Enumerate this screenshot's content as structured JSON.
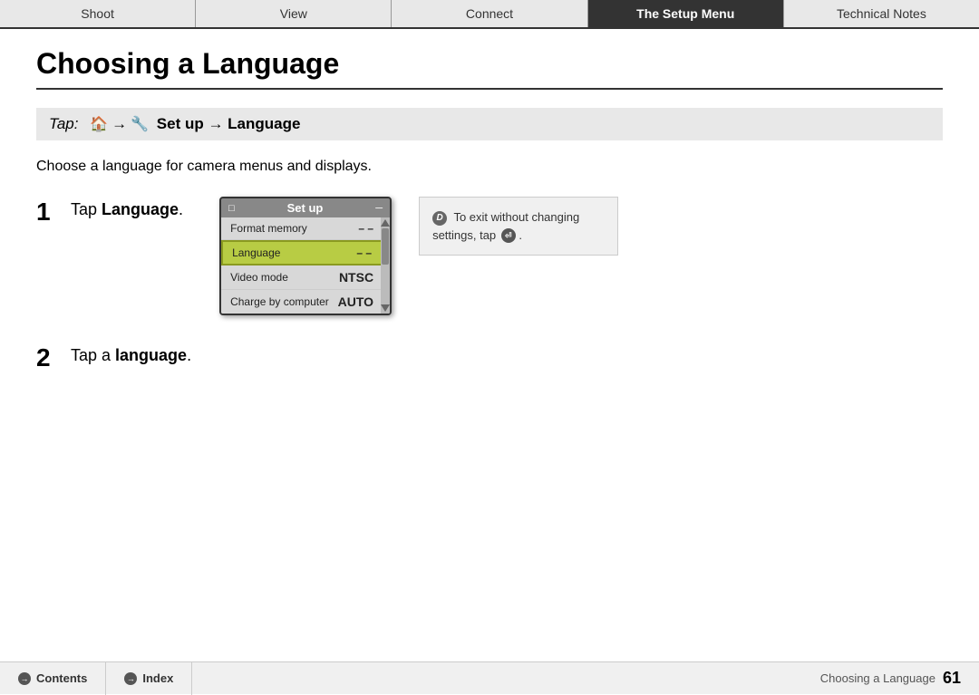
{
  "nav": {
    "tabs": [
      {
        "id": "shoot",
        "label": "Shoot",
        "active": false
      },
      {
        "id": "view",
        "label": "View",
        "active": false
      },
      {
        "id": "connect",
        "label": "Connect",
        "active": false
      },
      {
        "id": "setup",
        "label": "The Setup Menu",
        "active": true
      },
      {
        "id": "technical",
        "label": "Technical Notes",
        "active": false
      }
    ]
  },
  "page": {
    "title": "Choosing a Language",
    "tap_label": "Tap:",
    "tap_instruction": "Set up → Language",
    "description": "Choose a language for camera menus and displays.",
    "steps": [
      {
        "number": "1",
        "text_before": "Tap ",
        "bold": "Language",
        "text_after": "."
      },
      {
        "number": "2",
        "text_before": "Tap a ",
        "bold": "language",
        "text_after": "."
      }
    ]
  },
  "camera_screen": {
    "title": "Set up",
    "rows": [
      {
        "label": "Format memory",
        "value": "– –",
        "highlighted": false
      },
      {
        "label": "Language",
        "value": "– –",
        "highlighted": true
      },
      {
        "label": "Video mode",
        "value": "NTSC",
        "highlighted": false
      },
      {
        "label": "Charge by computer",
        "value": "AUTO",
        "highlighted": false
      }
    ]
  },
  "note": {
    "text_before": "To exit without changing settings, tap",
    "text_after": "."
  },
  "bottom": {
    "contents_label": "Contents",
    "index_label": "Index",
    "page_label": "Choosing a Language",
    "page_number": "61"
  }
}
